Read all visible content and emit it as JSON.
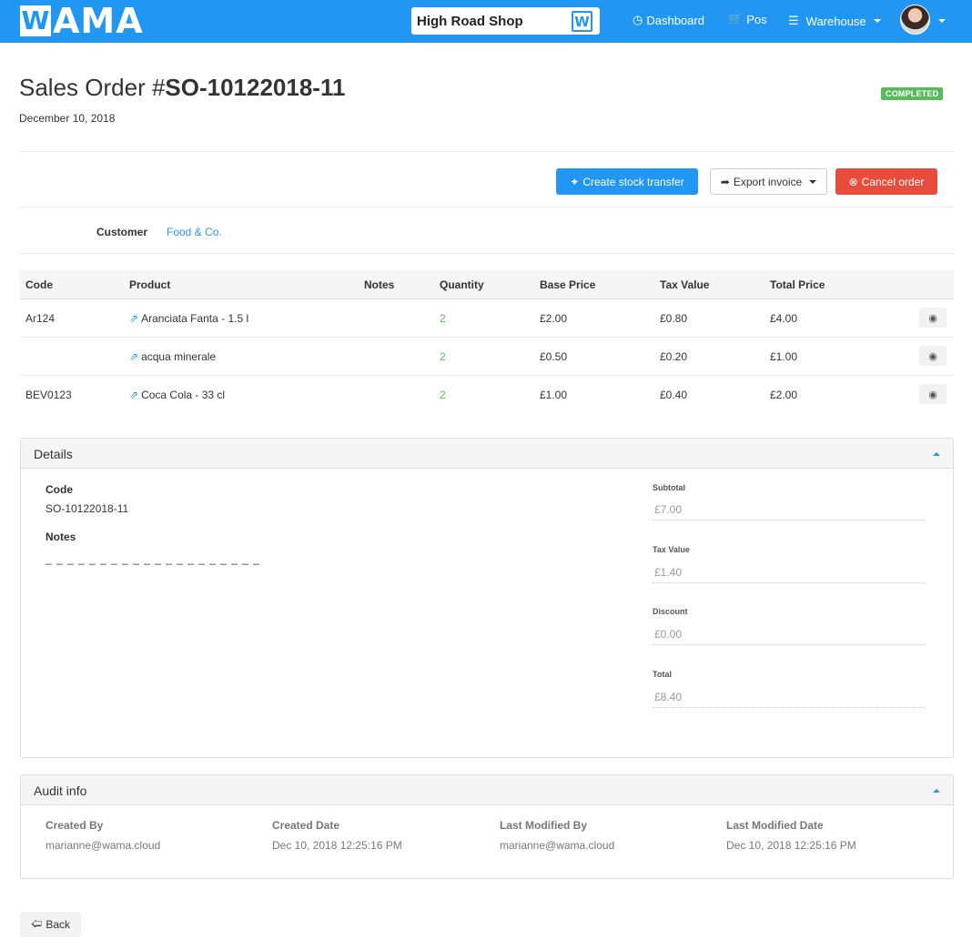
{
  "navbar": {
    "logo_first": "W",
    "logo_rest": "AMA",
    "shop_name": "High Road Shop",
    "shop_badge": "W",
    "dashboard_label": "Dashboard",
    "pos_label": "Pos",
    "warehouse_label": "Warehouse"
  },
  "header": {
    "title_prefix": "Sales Order #",
    "title_code": "SO-10122018-11",
    "date": "December 10, 2018",
    "status": "COMPLETED"
  },
  "actions": {
    "create_transfer": "Create stock transfer",
    "export_invoice": "Export invoice",
    "cancel_order": "Cancel order"
  },
  "customer": {
    "label": "Customer",
    "value": "Food & Co."
  },
  "table": {
    "headers": [
      "Code",
      "Product",
      "Notes",
      "Quantity",
      "Base Price",
      "Tax Value",
      "Total Price"
    ],
    "rows": [
      {
        "code": "Ar124",
        "product": "Aranciata Fanta - 1.5 l",
        "notes": "",
        "quantity": "2",
        "base_price": "£2.00",
        "tax_value": "£0.80",
        "total_price": "£4.00"
      },
      {
        "code": "",
        "product": "acqua minerale",
        "notes": "",
        "quantity": "2",
        "base_price": "£0.50",
        "tax_value": "£0.20",
        "total_price": "£1.00"
      },
      {
        "code": "BEV0123",
        "product": "Coca Cola - 33 cl",
        "notes": "",
        "quantity": "2",
        "base_price": "£1.00",
        "tax_value": "£0.40",
        "total_price": "£2.00"
      }
    ]
  },
  "details": {
    "title": "Details",
    "code_label": "Code",
    "code_value": "SO-10122018-11",
    "notes_label": "Notes",
    "notes_value": "_ _ _ _ _ _ _ _ _ _ _ _ _ _ _ _ _ _ _ _",
    "subtotal_label": "Subtotal",
    "subtotal_value": "£7.00",
    "tax_label": "Tax Value",
    "tax_value": "£1.40",
    "discount_label": "Discount",
    "discount_value": "£0.00",
    "total_label": "Total",
    "total_value": "£8.40"
  },
  "audit": {
    "title": "Audit info",
    "created_by_label": "Created By",
    "created_by": "marianne@wama.cloud",
    "created_date_label": "Created Date",
    "created_date": "Dec 10, 2018 12:25:16 PM",
    "modified_by_label": "Last Modified By",
    "modified_by": "marianne@wama.cloud",
    "modified_date_label": "Last Modified Date",
    "modified_date": "Dec 10, 2018 12:25:16 PM"
  },
  "back_label": "Back",
  "colors": {
    "primary": "#2196f3",
    "success": "#5cb85c",
    "danger": "#e74c3c"
  }
}
